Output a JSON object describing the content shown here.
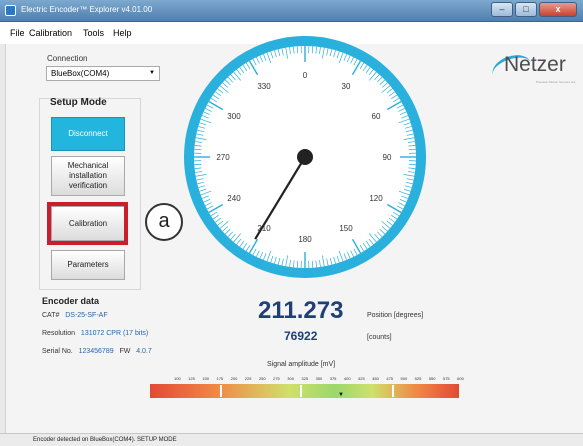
{
  "window": {
    "title": "Electric Encoder™ Explorer v4.01.00"
  },
  "menu": [
    "File",
    "Calibration",
    "Tools",
    "Help"
  ],
  "connection": {
    "label": "Connection",
    "value": "BlueBox(COM4)"
  },
  "setup": {
    "title": "Setup Mode",
    "buttons": [
      {
        "label": "Disconnect"
      },
      {
        "label": "Mechanical installation verification"
      },
      {
        "label": "Calibration"
      },
      {
        "label": "Parameters"
      }
    ],
    "callout": "a"
  },
  "logo": {
    "text": "Netzer",
    "tagline": "Precision Motion Sensors Ltd."
  },
  "gauge": {
    "labels": [
      "0",
      "30",
      "60",
      "90",
      "120",
      "150",
      "180",
      "210",
      "240",
      "270",
      "300",
      "330"
    ],
    "needle_deg": 211.273,
    "color": "#2ab0dc"
  },
  "encoder": {
    "title": "Encoder data",
    "cat_label": "CAT#",
    "cat_value": "DS-25-SF-AF",
    "res_label": "Resolution",
    "res_value": "131072 CPR (17 bits)",
    "serial_label": "Serial No.",
    "serial_value": "123456789",
    "fw_label": "FW",
    "fw_value": "4.0.7"
  },
  "position": {
    "value": "211.273",
    "unit": "Position [degrees]",
    "counts": "76922",
    "counts_unit": "[counts]"
  },
  "signal": {
    "label": "Signal amplitude [mV]",
    "ticks": [
      "100",
      "125",
      "150",
      "175",
      "200",
      "225",
      "250",
      "275",
      "300",
      "325",
      "350",
      "375",
      "400",
      "425",
      "450",
      "475",
      "500",
      "525",
      "550",
      "575",
      "600"
    ],
    "marker": "▼"
  },
  "status": "Encoder detected on BlueBox(COM4). SETUP MODE"
}
